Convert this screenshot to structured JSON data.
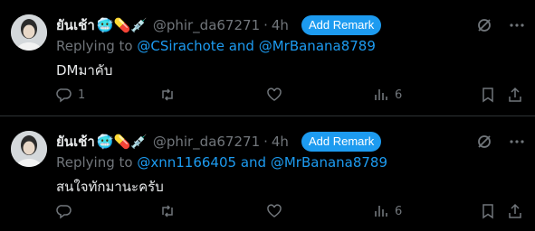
{
  "tweets": [
    {
      "user": {
        "display_name": "ยันเช้า",
        "emoji": "🥶💊💉",
        "handle": "@phir_da67271",
        "time": "4h"
      },
      "remark_button": "Add Remark",
      "replying_prefix": "Replying to",
      "mention1": "@CSirachote",
      "and_text": "and",
      "mention2": "@MrBanana8789",
      "text": "DMมาคับ",
      "stats": {
        "replies": "1",
        "retweets": "",
        "likes": "",
        "views": "6"
      }
    },
    {
      "user": {
        "display_name": "ยันเช้า",
        "emoji": "🥶💊💉",
        "handle": "@phir_da67271",
        "time": "4h"
      },
      "remark_button": "Add Remark",
      "replying_prefix": "Replying to",
      "mention1": "@xnn1166405",
      "and_text": "and",
      "mention2": "@MrBanana8789",
      "text": "สนใจทักมานะครับ",
      "stats": {
        "replies": "",
        "retweets": "",
        "likes": "",
        "views": "6"
      }
    }
  ],
  "icons": {
    "top_right": [
      "grok-icon",
      "more-icon"
    ],
    "actions": [
      "reply-icon",
      "retweet-icon",
      "like-icon",
      "views-icon",
      "bookmark-icon",
      "share-icon"
    ]
  },
  "colors": {
    "background": "#000000",
    "accent": "#1d9bf0",
    "muted": "#71767b",
    "text": "#e7e9ea",
    "divider": "#2f3336"
  }
}
